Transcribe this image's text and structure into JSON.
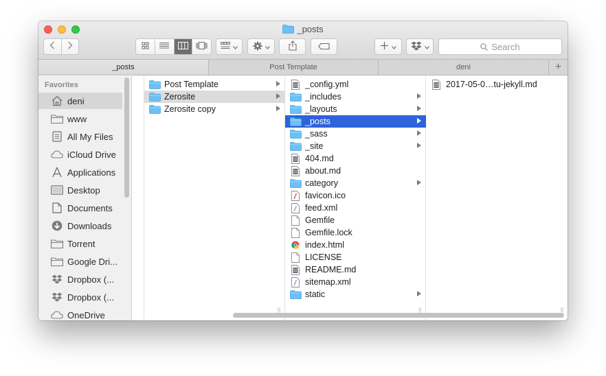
{
  "window": {
    "title": "_posts"
  },
  "toolbar": {
    "search_placeholder": "Search"
  },
  "tabs": [
    {
      "label": "_posts",
      "active": true
    },
    {
      "label": "Post Template",
      "active": false
    },
    {
      "label": "deni",
      "active": false
    }
  ],
  "sidebar": {
    "heading": "Favorites",
    "items": [
      {
        "label": "deni",
        "icon": "home-icon",
        "selected": true
      },
      {
        "label": "www",
        "icon": "folder-icon",
        "selected": false
      },
      {
        "label": "All My Files",
        "icon": "all-files-icon",
        "selected": false
      },
      {
        "label": "iCloud Drive",
        "icon": "cloud-icon",
        "selected": false
      },
      {
        "label": "Applications",
        "icon": "applications-icon",
        "selected": false
      },
      {
        "label": "Desktop",
        "icon": "desktop-icon",
        "selected": false
      },
      {
        "label": "Documents",
        "icon": "documents-icon",
        "selected": false
      },
      {
        "label": "Downloads",
        "icon": "downloads-icon",
        "selected": false
      },
      {
        "label": "Torrent",
        "icon": "folder-icon",
        "selected": false
      },
      {
        "label": "Google Dri...",
        "icon": "folder-icon",
        "selected": false
      },
      {
        "label": "Dropbox (...",
        "icon": "dropbox-icon",
        "selected": false
      },
      {
        "label": "Dropbox (...",
        "icon": "dropbox-icon",
        "selected": false
      },
      {
        "label": "OneDrive",
        "icon": "cloud-icon",
        "selected": false
      }
    ]
  },
  "columns": {
    "col1": [
      {
        "label": "Post Template",
        "type": "folder",
        "hasChildren": true,
        "state": "none"
      },
      {
        "label": "Zerosite",
        "type": "folder",
        "hasChildren": true,
        "state": "highlight"
      },
      {
        "label": "Zerosite copy",
        "type": "folder",
        "hasChildren": true,
        "state": "none"
      }
    ],
    "col2": [
      {
        "label": "_config.yml",
        "type": "text-file",
        "hasChildren": false,
        "state": "none"
      },
      {
        "label": "_includes",
        "type": "folder",
        "hasChildren": true,
        "state": "none"
      },
      {
        "label": "_layouts",
        "type": "folder",
        "hasChildren": true,
        "state": "none"
      },
      {
        "label": "_posts",
        "type": "folder",
        "hasChildren": true,
        "state": "selected"
      },
      {
        "label": "_sass",
        "type": "folder",
        "hasChildren": true,
        "state": "none"
      },
      {
        "label": "_site",
        "type": "folder",
        "hasChildren": true,
        "state": "none"
      },
      {
        "label": "404.md",
        "type": "text-file",
        "hasChildren": false,
        "state": "none"
      },
      {
        "label": "about.md",
        "type": "text-file",
        "hasChildren": false,
        "state": "none"
      },
      {
        "label": "category",
        "type": "folder",
        "hasChildren": true,
        "state": "none"
      },
      {
        "label": "favicon.ico",
        "type": "ico-file",
        "hasChildren": false,
        "state": "none"
      },
      {
        "label": "feed.xml",
        "type": "xml-file",
        "hasChildren": false,
        "state": "none"
      },
      {
        "label": "Gemfile",
        "type": "blank-file",
        "hasChildren": false,
        "state": "none"
      },
      {
        "label": "Gemfile.lock",
        "type": "blank-file",
        "hasChildren": false,
        "state": "none"
      },
      {
        "label": "index.html",
        "type": "html-file",
        "hasChildren": false,
        "state": "none"
      },
      {
        "label": "LICENSE",
        "type": "blank-file",
        "hasChildren": false,
        "state": "none"
      },
      {
        "label": "README.md",
        "type": "text-file",
        "hasChildren": false,
        "state": "none"
      },
      {
        "label": "sitemap.xml",
        "type": "xml-file",
        "hasChildren": false,
        "state": "none"
      },
      {
        "label": "static",
        "type": "folder",
        "hasChildren": true,
        "state": "none"
      }
    ],
    "col3": [
      {
        "label": "2017-05-0…tu-jekyll.md",
        "type": "text-file",
        "hasChildren": false,
        "state": "none"
      }
    ]
  },
  "colors": {
    "folder": "#6cc0f5",
    "selection": "#2f63db",
    "highlight": "#dcdcdc"
  }
}
